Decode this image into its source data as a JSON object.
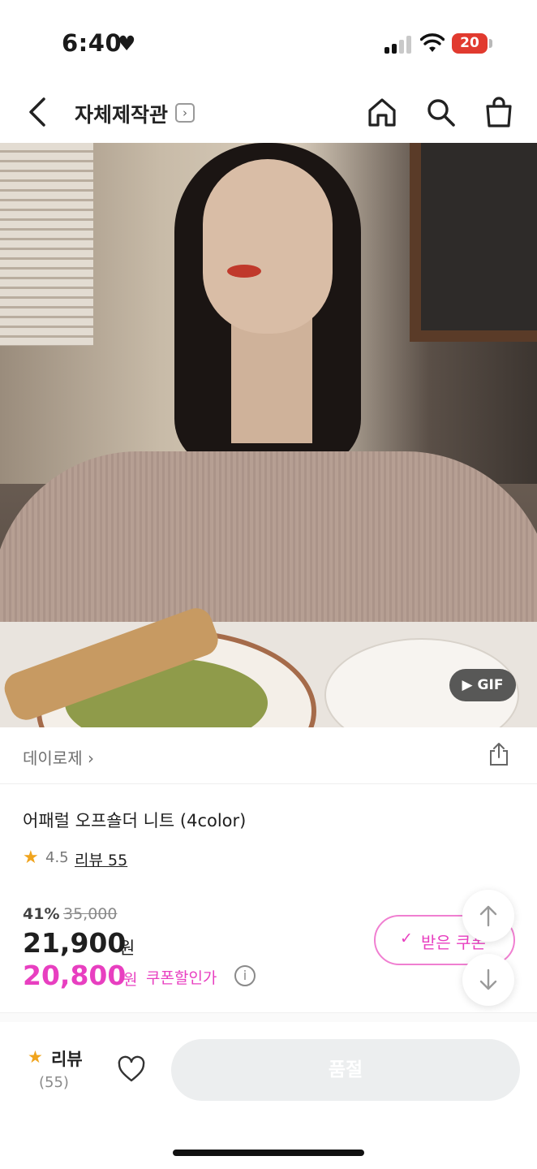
{
  "status_bar": {
    "time": "6:40",
    "battery": "20"
  },
  "nav": {
    "store_name": "자체제작관",
    "store_arrow": "›"
  },
  "hero": {
    "gif_label": "▶ GIF"
  },
  "seller": {
    "name": "데이로제 ›"
  },
  "product": {
    "title": "어패럴 오프숄더 니트 (4color)",
    "rating": "4.5",
    "reviews_link": "리뷰 55",
    "discount_rate": "41%",
    "original_price": "35,000",
    "price": "21,900",
    "price_unit": "원",
    "coupon_price": "20,800",
    "coupon_price_unit": "원",
    "coupon_price_label": "쿠폰할인가",
    "info_icon": "i"
  },
  "coupon_button": {
    "check": "✓",
    "label": "받은 쿠폰"
  },
  "bottom_bar": {
    "review_star": "★",
    "review_label": "리뷰",
    "review_count": "(55)",
    "buy_label": "품절"
  },
  "colors": {
    "accent_pink": "#e83fc0",
    "star": "#f0a41d",
    "disabled_button": "#eceeef"
  }
}
